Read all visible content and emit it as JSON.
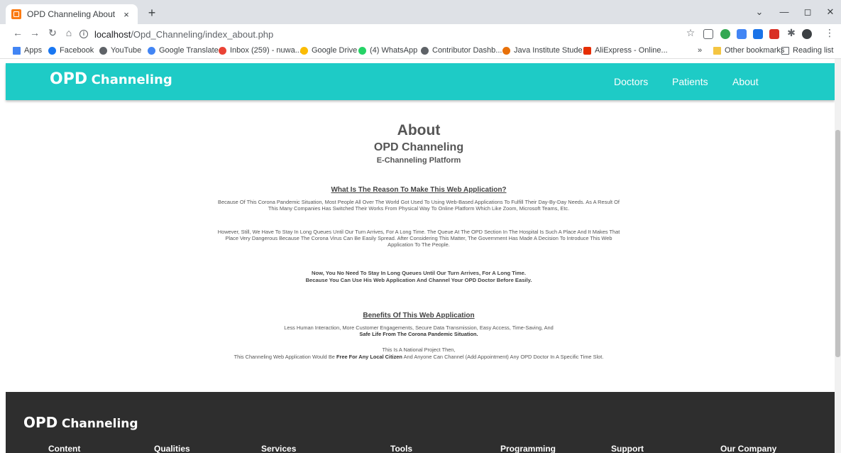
{
  "browser": {
    "tab_title": "OPD Channeling About",
    "tab_close": "×",
    "new_tab": "+",
    "url_host": "localhost",
    "url_path": "/Opd_Channeling/index_about.php",
    "controls": {
      "minimize": "—",
      "maximize": "◻",
      "close": "✕",
      "chevron": "⌄"
    }
  },
  "bookmarks": [
    {
      "label": "Apps",
      "color": "#4285f4"
    },
    {
      "label": "Facebook",
      "color": "#1877f2"
    },
    {
      "label": "YouTube",
      "color": "#5f6368"
    },
    {
      "label": "Google Translate",
      "color": "#4285f4"
    },
    {
      "label": "Inbox (259) - nuwa...",
      "color": "#ea4335"
    },
    {
      "label": "Google Drive",
      "color": "#fbbc04"
    },
    {
      "label": "(4) WhatsApp",
      "color": "#25d366"
    },
    {
      "label": "Contributor Dashb...",
      "color": "#5f6368"
    },
    {
      "label": "Java Institute Stude...",
      "color": "#e8710a"
    },
    {
      "label": "AliExpress - Online...",
      "color": "#e62e04"
    },
    {
      "label": "»",
      "color": ""
    },
    {
      "label": "Other bookmarks",
      "color": "#f4c542"
    },
    {
      "label": "Reading list",
      "color": "#5f6368"
    }
  ],
  "nav": {
    "brand_big": "OPD",
    "brand_small": "Channeling",
    "links": [
      "Doctors",
      "Patients",
      "About"
    ],
    "bg": "#1ecbc6"
  },
  "about": {
    "title": "About",
    "subtitle": "OPD Channeling",
    "subtitle2": "E-Channeling Platform",
    "question": "What Is The Reason To Make This Web Application?",
    "para1": "Because Of This Corona Pandemic Situation, Most People All Over The World Got Used To Using Web-Based Applications To Fulfill Their Day-By-Day Needs. As A Result Of This Many Companies Has Switched Their Works From Physical Way To Online Platform Which Like Zoom, Microsoft Teams, Etc.",
    "para2": "However, Still, We Have To Stay In Long Queues Until Our Turn Arrives, For A Long Time. The Queue At The OPD Section In The Hospital Is Such A Place And It Makes That Place Very Dangerous Because The Corona Virus Can Be Easily Spread. After Considering This Matter, The Government Has Made A Decision To Introduce This Web Application To The People.",
    "note1": "Now, You No Need To Stay In Long Queues Until Our Turn Arrives, For A Long Time.",
    "note2": "Because You Can Use His Web Application And Channel Your OPD Doctor Before Easily.",
    "benefits_title": "Benefits Of This Web Application",
    "benefits_text": "Less Human Interaction, More Customer Engagements, Secure Data Transmission, Easy Access, Time-Saving, And",
    "benefits_bold": "Safe Life From The Corona Pandemic Situation.",
    "national_line": "This Is A National Project Then,",
    "free_pre": "This Channeling Web Application Would Be",
    "free_bold": "Free For Any Local Citizen",
    "free_post": "And Anyone Can Channel (Add Appointment) Any OPD Doctor In A Specific Time Slot."
  },
  "footer": {
    "brand_big": "OPD",
    "brand_small": "Channeling",
    "columns": [
      "Content",
      "Qualities",
      "Services",
      "Tools",
      "Programming",
      "Support",
      "Our Company"
    ]
  }
}
